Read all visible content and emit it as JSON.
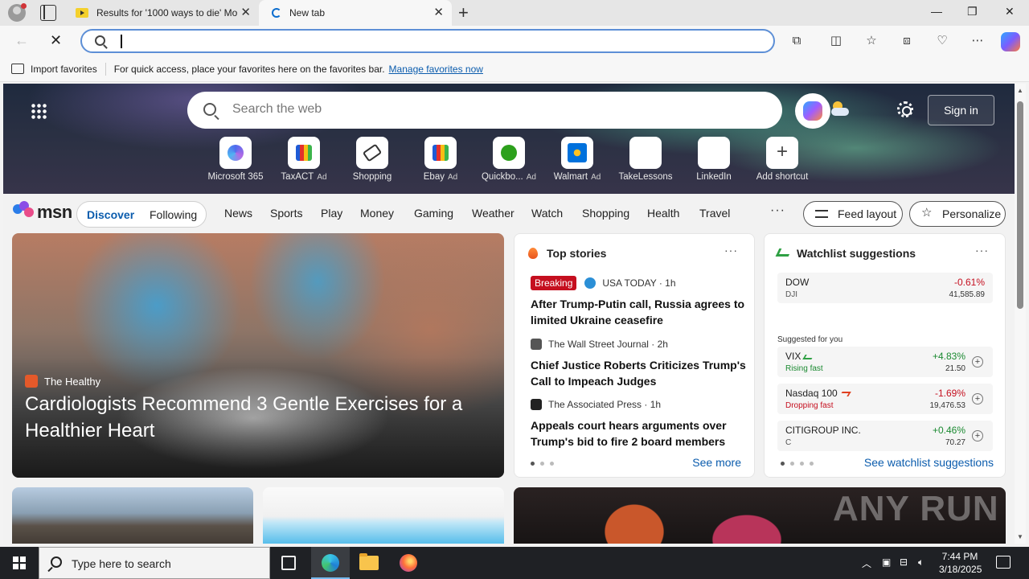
{
  "browser": {
    "tabs": [
      {
        "title": "Results for '1000 ways to die' Mo",
        "active": false
      },
      {
        "title": "New tab",
        "active": true
      }
    ],
    "address_value": "",
    "favorites_bar": {
      "import_label": "Import favorites",
      "hint": "For quick access, place your favorites here on the favorites bar.",
      "manage_link": "Manage favorites now"
    }
  },
  "newtab": {
    "search_placeholder": "Search the web",
    "sign_in": "Sign in",
    "shortcuts": [
      {
        "label": "Microsoft 365",
        "ad": "",
        "icon": "m365-icon"
      },
      {
        "label": "TaxACT",
        "ad": "Ad",
        "icon": "taxact-icon"
      },
      {
        "label": "Shopping",
        "ad": "",
        "icon": "tag-icon"
      },
      {
        "label": "Ebay",
        "ad": "Ad",
        "icon": "ebay-icon"
      },
      {
        "label": "Quickbo...",
        "ad": "Ad",
        "icon": "quickbooks-icon"
      },
      {
        "label": "Walmart",
        "ad": "Ad",
        "icon": "walmart-icon"
      },
      {
        "label": "TakeLessons",
        "ad": "",
        "icon": "takelessons-icon"
      },
      {
        "label": "LinkedIn",
        "ad": "",
        "icon": "linkedin-icon"
      },
      {
        "label": "Add shortcut",
        "ad": "",
        "icon": "plus-icon"
      }
    ]
  },
  "msn": {
    "logo_text": "msn",
    "feed_tabs": [
      "Discover",
      "Following"
    ],
    "nav": [
      "News",
      "Sports",
      "Play",
      "Money",
      "Gaming",
      "Weather",
      "Watch",
      "Shopping",
      "Health",
      "Travel"
    ],
    "more": "···",
    "feed_layout": "Feed layout",
    "personalize": "Personalize"
  },
  "hero": {
    "source": "The Healthy",
    "title": "Cardiologists Recommend 3 Gentle Exercises for a Healthier Heart"
  },
  "top_stories": {
    "heading": "Top stories",
    "more": "···",
    "items": [
      {
        "badge": "Breaking",
        "source": "USA TODAY · 1h",
        "title": "After Trump-Putin call, Russia agrees to limited Ukraine ceasefire"
      },
      {
        "badge": "",
        "source": "The Wall Street Journal · 2h",
        "title": "Chief Justice Roberts Criticizes Trump's Call to Impeach Judges"
      },
      {
        "badge": "",
        "source": "The Associated Press · 1h",
        "title": "Appeals court hears arguments over Trump's bid to fire 2 board members"
      }
    ],
    "see_more": "See more"
  },
  "watchlist": {
    "heading": "Watchlist suggestions",
    "more": "···",
    "main": {
      "name": "DOW",
      "sub": "DJI",
      "change": "-0.61%",
      "value": "41,585.89"
    },
    "suggested_label": "Suggested for you",
    "items": [
      {
        "name": "VIX",
        "sub": "Rising fast",
        "change": "+4.83%",
        "value": "21.50",
        "trend": "up"
      },
      {
        "name": "Nasdaq 100",
        "sub": "Dropping fast",
        "change": "-1.69%",
        "value": "19,476.53",
        "trend": "down"
      },
      {
        "name": "CITIGROUP INC.",
        "sub": "C",
        "change": "+0.46%",
        "value": "70.27",
        "trend": "up"
      }
    ],
    "see_more": "See watchlist suggestions"
  },
  "watermark": "ANY RUN",
  "taskbar": {
    "search_placeholder": "Type here to search",
    "time": "7:44 PM",
    "date": "3/18/2025"
  }
}
